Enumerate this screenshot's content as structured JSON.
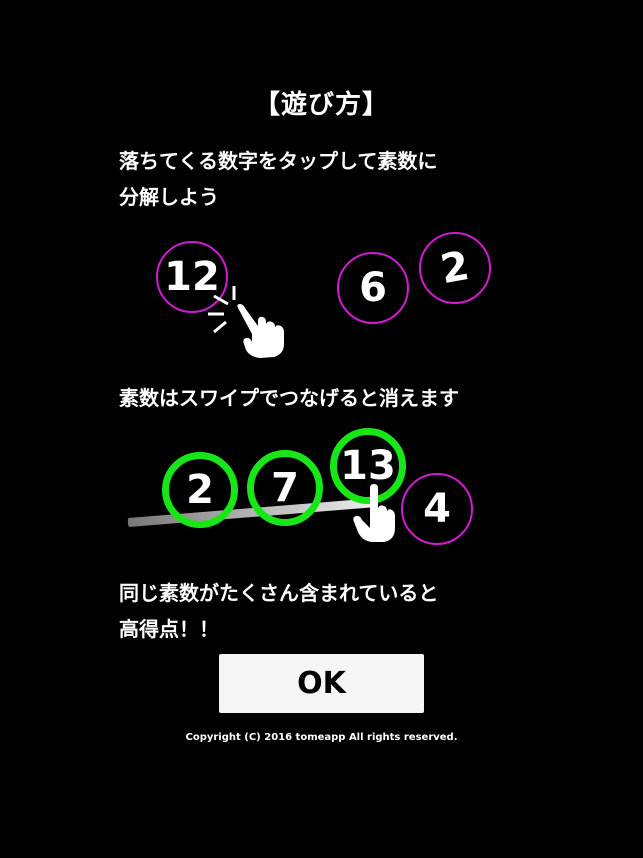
{
  "title": "【遊び方】",
  "instructions": {
    "step1": [
      "落ちてくる数字をタップして素数に",
      "分解しよう"
    ],
    "step2": [
      "素数はスワイプでつなげると消えます"
    ],
    "step3": [
      "同じ素数がたくさん含まれていると",
      "高得点！！"
    ]
  },
  "illustration1": {
    "circles": [
      "12",
      "6",
      "2"
    ]
  },
  "illustration2": {
    "circles": [
      "2",
      "7",
      "13",
      "4"
    ]
  },
  "colors": {
    "background": "#000000",
    "circle_unselected": "#d21ad2",
    "circle_selected": "#19e619",
    "button_bg": "#f5f5f5"
  },
  "icons": {
    "hand": "pointing-hand-icon"
  },
  "ok_label": "OK",
  "copyright": "Copyright (C) 2016 tomeapp All rights reserved."
}
